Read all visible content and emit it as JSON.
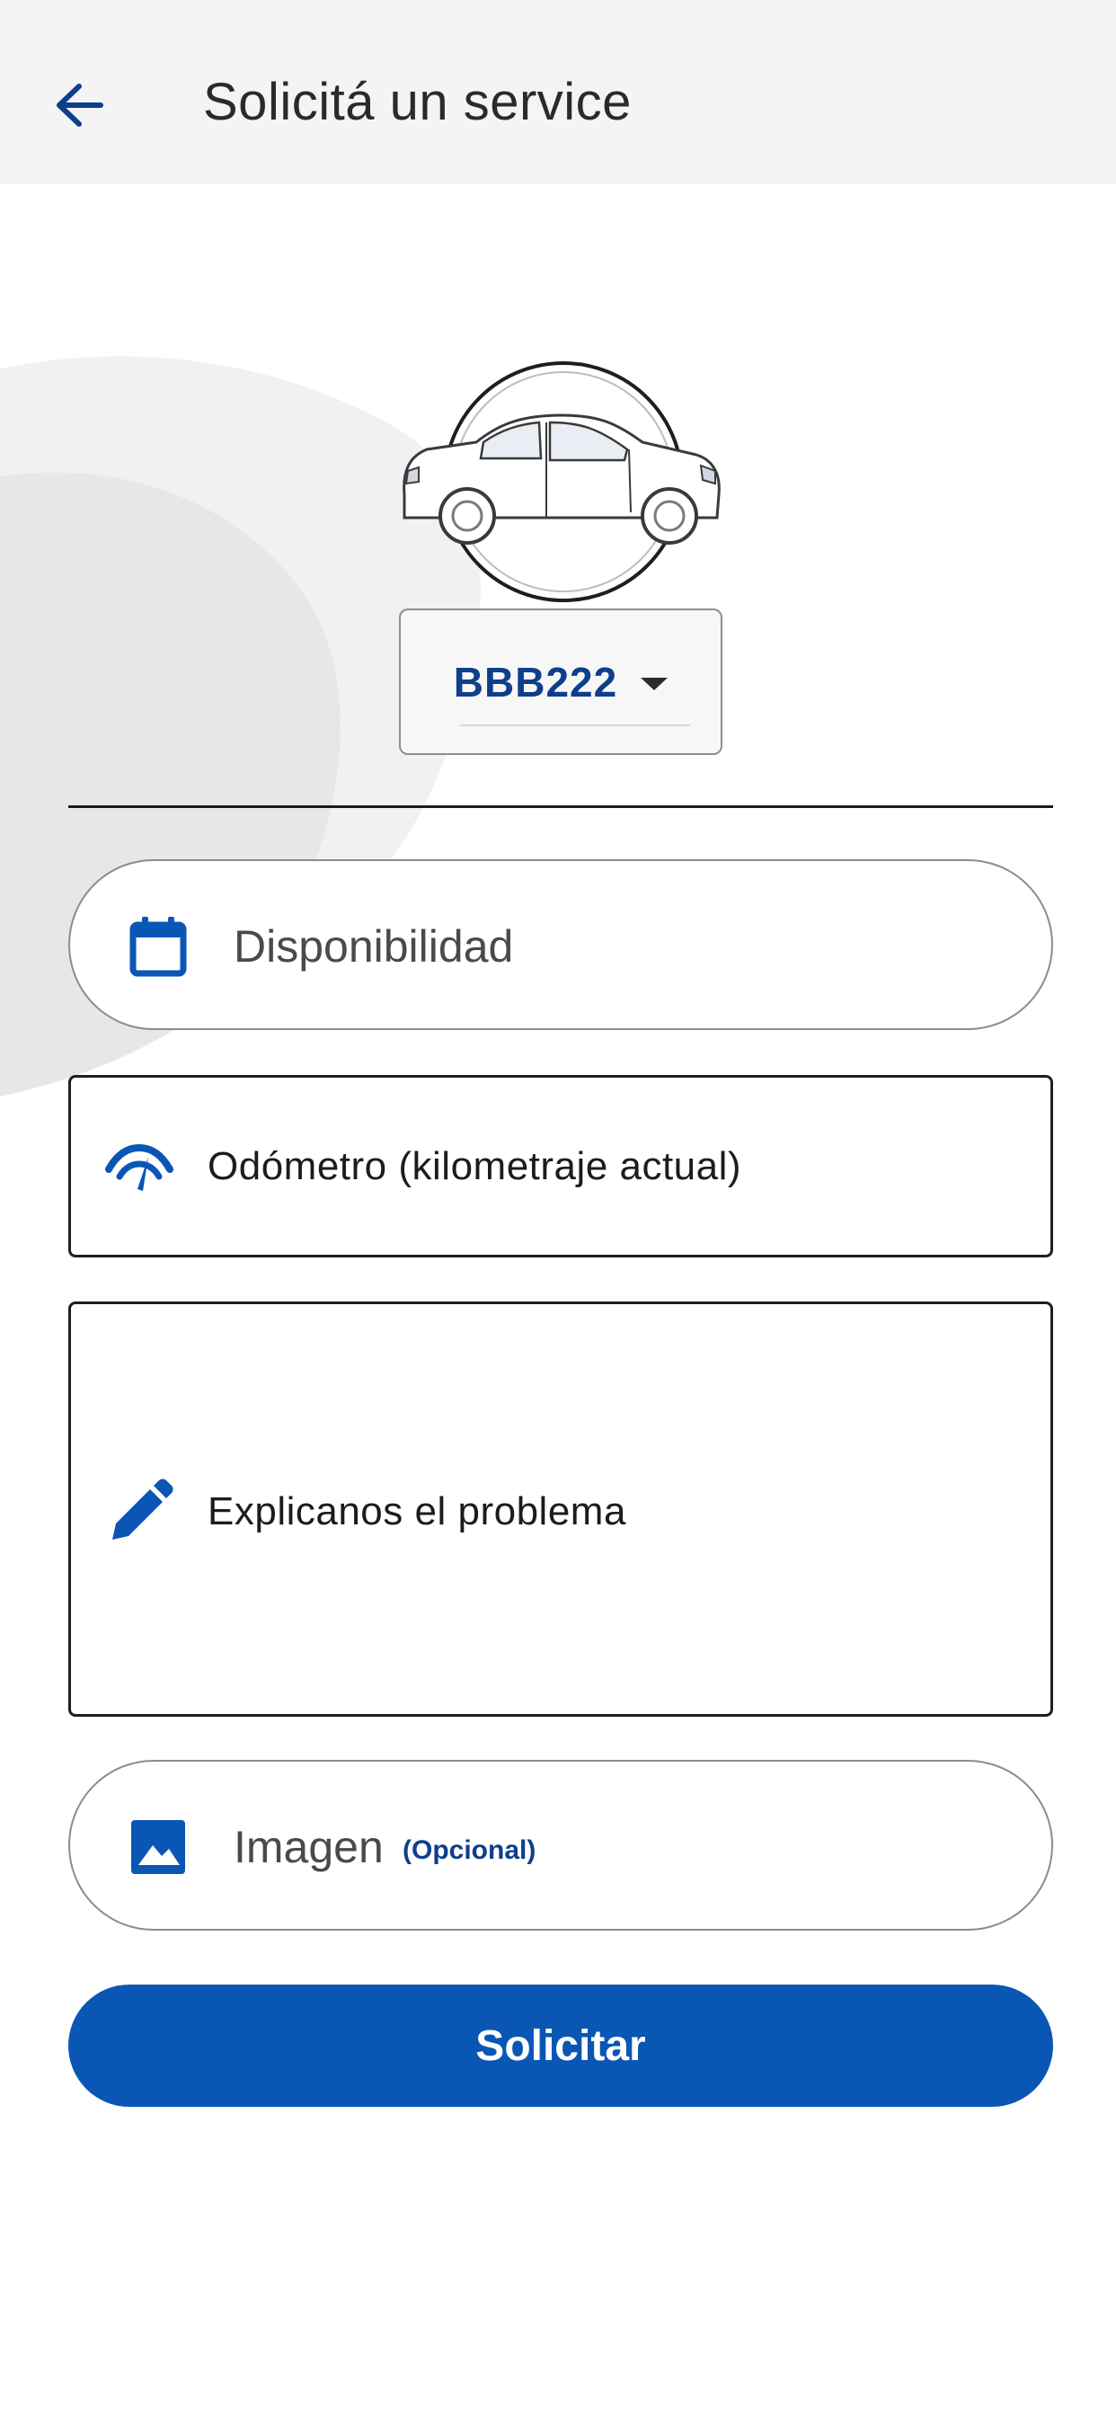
{
  "header": {
    "title": "Solicitá un service",
    "back_icon": "arrow-left-icon"
  },
  "vehicle": {
    "avatar_icon": "car-icon",
    "plate": "BBB222",
    "dropdown_icon": "caret-down-icon"
  },
  "form": {
    "availability": {
      "label": "Disponibilidad",
      "icon": "calendar-icon"
    },
    "odometer": {
      "placeholder": "Odómetro (kilometraje actual)",
      "value": "",
      "icon": "gauge-icon"
    },
    "problem": {
      "placeholder": "Explicanos el problema",
      "value": "",
      "icon": "pencil-icon"
    },
    "image": {
      "label": "Imagen",
      "optional": "(Opcional)",
      "icon": "image-icon"
    },
    "submit_label": "Solicitar"
  },
  "colors": {
    "accent": "#0a56b5",
    "accent_dark": "#0d3f8c",
    "header_bg": "#f4f4f4",
    "text_primary": "#1c1c1c",
    "text_muted": "#4a4a4a"
  }
}
